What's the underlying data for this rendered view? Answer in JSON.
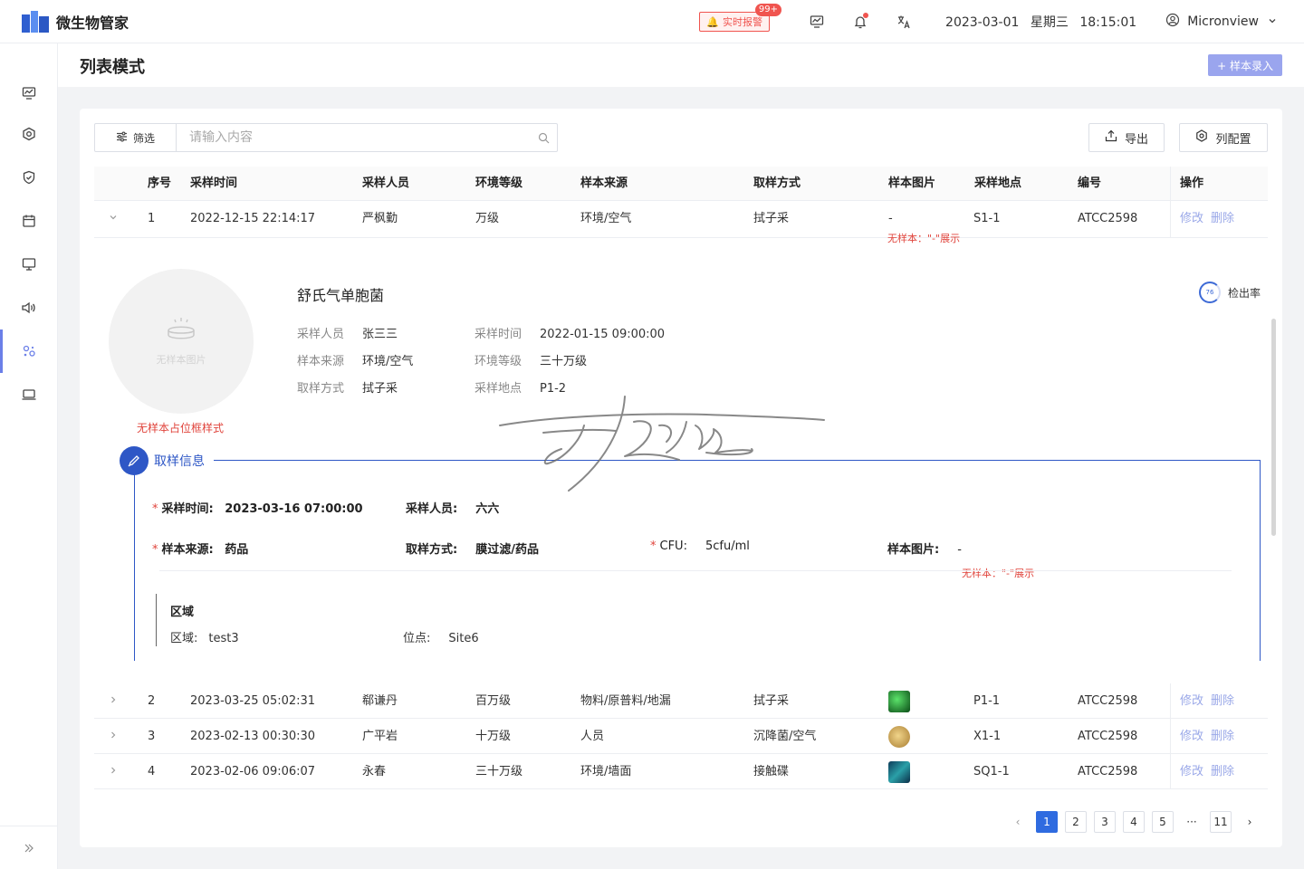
{
  "brand": {
    "name": "微生物管家"
  },
  "topbar": {
    "alarm_label": "实时报警",
    "alarm_badge": "99+",
    "date": "2023-03-01",
    "weekday": "星期三",
    "time": "18:15:01",
    "user": "Micronview"
  },
  "page": {
    "title": "列表模式",
    "add_button": "+ 样本录入"
  },
  "toolbar": {
    "filter_label": "筛选",
    "search_placeholder": "请输入内容",
    "export_label": "导出",
    "columns_label": "列配置"
  },
  "table": {
    "headers": [
      "序号",
      "采样时间",
      "采样人员",
      "环境等级",
      "样本来源",
      "取样方式",
      "样本图片",
      "采样地点",
      "编号",
      "操作"
    ],
    "edit_label": "修改",
    "delete_label": "删除",
    "rows": [
      {
        "no": "1",
        "time": "2022-12-15 22:14:17",
        "person": "严枫勤",
        "level": "万级",
        "source": "环境/空气",
        "method": "拭子采",
        "image": "-",
        "image_note": "无样本：\"-\"展示",
        "location": "S1-1",
        "code": "ATCC2598"
      },
      {
        "no": "2",
        "time": "2023-03-25 05:02:31",
        "person": "郗谦丹",
        "level": "百万级",
        "source": "物料/原普料/地漏",
        "method": "拭子采",
        "thumb_color": "#1f8a2e",
        "location": "P1-1",
        "code": "ATCC2598"
      },
      {
        "no": "3",
        "time": "2023-02-13 00:30:30",
        "person": "广平岩",
        "level": "十万级",
        "source": "人员",
        "method": "沉降菌/空气",
        "thumb_color": "#d8b060",
        "location": "X1-1",
        "code": "ATCC2598"
      },
      {
        "no": "4",
        "time": "2023-02-06 09:06:07",
        "person": "永春",
        "level": "三十万级",
        "source": "环境/墙面",
        "method": "接触碟",
        "thumb_color": "#1c6a84",
        "location": "SQ1-1",
        "code": "ATCC2598"
      }
    ]
  },
  "detail": {
    "avatar_text": "无样本图片",
    "avatar_caption": "无样本占位框样式",
    "species": "舒氏气单胞菌",
    "detect_rate_value": "76",
    "detect_rate_label": "检出率",
    "fields": {
      "person_k": "采样人员",
      "person_v": "张三三",
      "time_k": "采样时间",
      "time_v": "2022-01-15 09:00:00",
      "source_k": "样本来源",
      "source_v": "环境/空气",
      "level_k": "环境等级",
      "level_v": "三十万级",
      "method_k": "取样方式",
      "method_v": "拭子采",
      "loc_k": "采样地点",
      "loc_v": "P1-2"
    },
    "section_title": "取样信息",
    "sampling": {
      "time_k": "采样时间:",
      "time_v": "2023-03-16 07:00:00",
      "person_k": "采样人员:",
      "person_v": "六六",
      "source_k": "样本来源:",
      "source_v": "药品",
      "method_k": "取样方式:",
      "method_v": "膜过滤/药品",
      "cfu_k": "CFU:",
      "cfu_v": "5cfu/ml",
      "image_k": "样本图片:",
      "image_v": "-",
      "image_note": "无样本：\"-\"展示",
      "region_title": "区域",
      "region_k": "区域:",
      "region_v": "test3",
      "site_k": "位点:",
      "site_v": "Site6"
    }
  },
  "pagination": {
    "pages": [
      "1",
      "2",
      "3",
      "4",
      "5"
    ],
    "ellipsis": "···",
    "last": "11",
    "prev": "‹",
    "next": "›"
  },
  "colors": {
    "primary": "#2f6be0",
    "accent": "#2e57c6",
    "danger": "#e0443c",
    "link": "#9aa8e8"
  }
}
